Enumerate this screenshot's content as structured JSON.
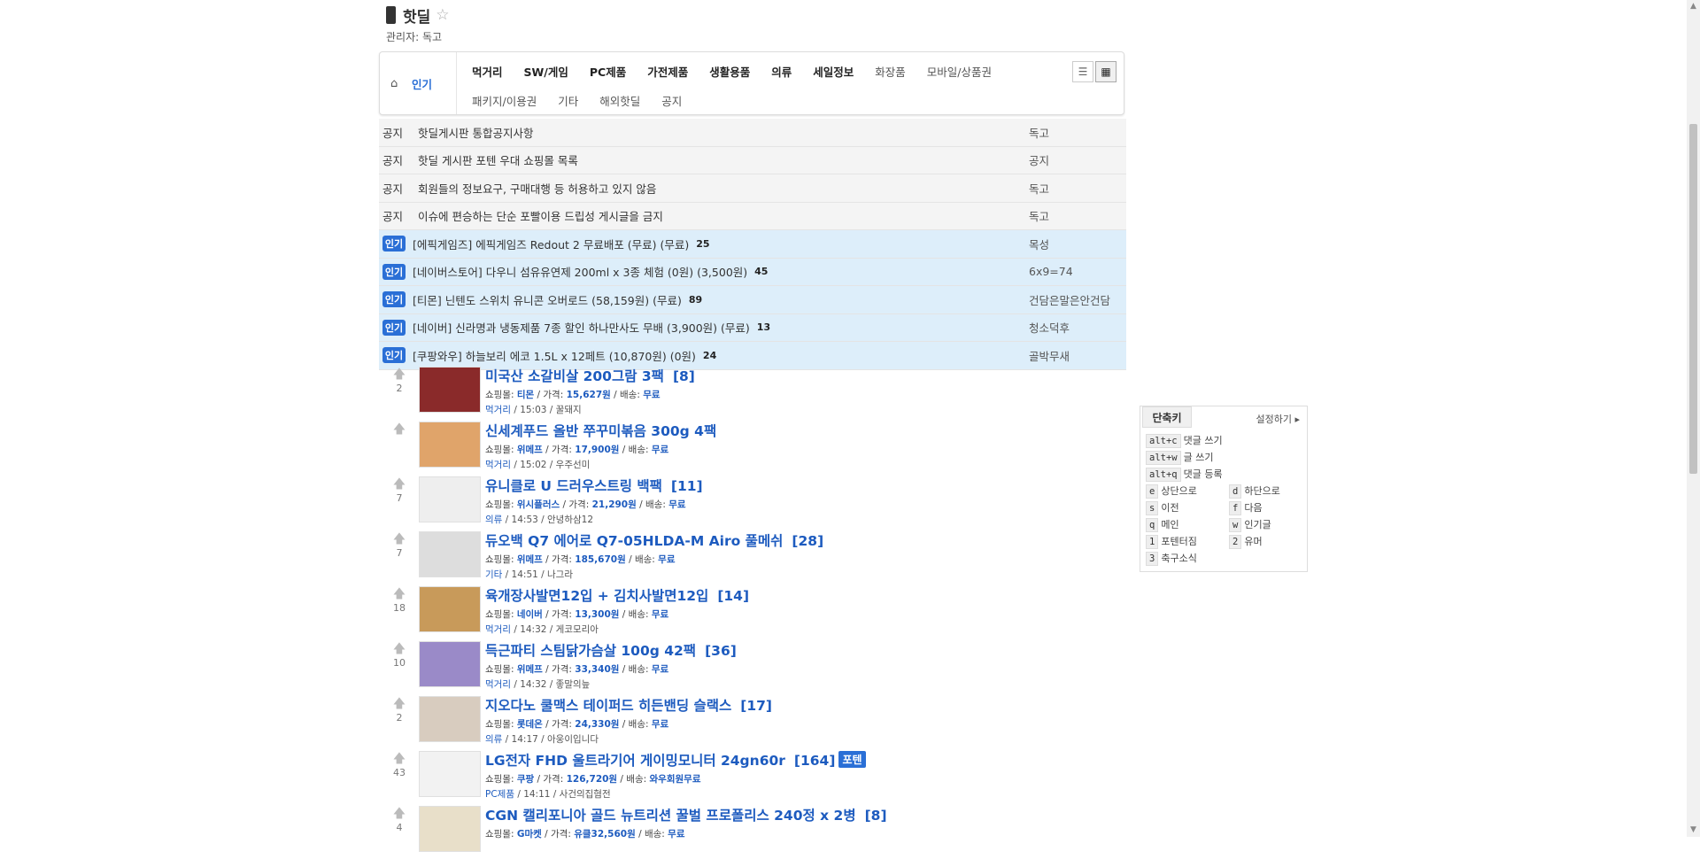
{
  "board": {
    "title": "핫딜",
    "admin": "관리자: 독고"
  },
  "nav": {
    "popular": "인기",
    "row1": [
      "먹거리",
      "SW/게임",
      "PC제품",
      "가전제품",
      "생활용품",
      "의류",
      "세일정보",
      "화장품",
      "모바일/상품권"
    ],
    "row2": [
      "패키지/이용권",
      "기타",
      "해외핫딜",
      "공지"
    ]
  },
  "notices": [
    {
      "tag": "공지",
      "subject": "핫딜게시판 통합공지사항",
      "author": "독고"
    },
    {
      "tag": "공지",
      "subject": "핫딜 게시판 포텐 우대 쇼핑몰 목록",
      "author": "공지"
    },
    {
      "tag": "공지",
      "subject": "회원들의 정보요구, 구매대행 등 허용하고 있지 않음",
      "author": "독고"
    },
    {
      "tag": "공지",
      "subject": "이슈에 편승하는 단순 포빨이용 드립성 게시글을 금지",
      "author": "독고"
    }
  ],
  "hot": [
    {
      "tag": "인기",
      "subject": "[에픽게임즈] 에픽게임즈 Redout 2 무료배포 (무료) (무료)",
      "comments": "25",
      "author": "목성"
    },
    {
      "tag": "인기",
      "subject": "[네이버스토어] 다우니 섬유유연제 200ml x 3종 체험 (0원) (3,500원)",
      "comments": "45",
      "author": "6x9=74"
    },
    {
      "tag": "인기",
      "subject": "[티몬] 닌텐도 스위치 유니콘 오버로드 (58,159원) (무료)",
      "comments": "89",
      "author": "건담은말은안건담"
    },
    {
      "tag": "인기",
      "subject": "[네이버] 신라명과 냉동제품 7종 할인 하나만사도 무배 (3,900원) (무료)",
      "comments": "13",
      "author": "청소덕후"
    },
    {
      "tag": "인기",
      "subject": "[쿠팡와우] 하늘보리 에코 1.5L x 12페트 (10,870원) (0원)",
      "comments": "24",
      "author": "골박무새"
    }
  ],
  "deal_labels": {
    "shop": "쇼핑몰: ",
    "price": " / 가격: ",
    "ship": " / 배송: "
  },
  "deals": [
    {
      "votes": "2",
      "title": "미국산 소갈비살 200그람 3팩",
      "count": "[8]",
      "shop": "티몬",
      "price": "15,627원",
      "ship": "무료",
      "cat": "먹거리",
      "time_user": " / 15:03 / 꿀돼지",
      "badge": ""
    },
    {
      "votes": "",
      "title": "신세계푸드 올반 쭈꾸미볶음 300g 4팩",
      "count": "",
      "shop": "위메프",
      "price": "17,900원",
      "ship": "무료",
      "cat": "먹거리",
      "time_user": " / 15:02 / 우주선미",
      "badge": ""
    },
    {
      "votes": "7",
      "title": "유니클로 U 드러우스트링 백팩",
      "count": "[11]",
      "shop": "위시플러스",
      "price": "21,290원",
      "ship": "무료",
      "cat": "의류",
      "time_user": " / 14:53 / 안녕하삼12",
      "badge": ""
    },
    {
      "votes": "7",
      "title": "듀오백 Q7 에어로 Q7-05HLDA-M Airo 풀메쉬",
      "count": "[28]",
      "shop": "위메프",
      "price": "185,670원",
      "ship": "무료",
      "cat": "기타",
      "time_user": " / 14:51 / 나그라",
      "badge": ""
    },
    {
      "votes": "18",
      "title": "육개장사발면12입 + 김치사발면12입",
      "count": "[14]",
      "shop": "네이버",
      "price": "13,300원",
      "ship": "무료",
      "cat": "먹거리",
      "time_user": " / 14:32 / 게코모리아",
      "badge": ""
    },
    {
      "votes": "10",
      "title": "득근파티 스팀닭가슴살 100g 42팩",
      "count": "[36]",
      "shop": "위메프",
      "price": "33,340원",
      "ship": "무료",
      "cat": "먹거리",
      "time_user": " / 14:32 / 좋말의늪",
      "badge": ""
    },
    {
      "votes": "2",
      "title": "지오다노 쿨맥스 테이퍼드 히든밴딩 슬랙스",
      "count": "[17]",
      "shop": "롯데온",
      "price": "24,330원",
      "ship": "무료",
      "cat": "의류",
      "time_user": " / 14:17 / 아웅이입니다",
      "badge": ""
    },
    {
      "votes": "43",
      "title": "LG전자 FHD 울트라기어 게이밍모니터 24gn60r",
      "count": "[164]",
      "shop": "쿠팡",
      "price": "126,720원",
      "ship": "와우회원무료",
      "cat": "PC제품",
      "time_user": " / 14:11 / 사건의집혐전",
      "badge": "포텐"
    },
    {
      "votes": "4",
      "title": "CGN 캘리포니아 골드 뉴트리션 꿀벌 프로폴리스 240정 x 2병",
      "count": "[8]",
      "shop": "G마켓",
      "price": "유클32,560원",
      "ship": "무료",
      "cat": "",
      "time_user": "",
      "badge": ""
    }
  ],
  "shortcut": {
    "tab": "단축키",
    "settings": "설정하기",
    "left": [
      {
        "key": "alt+c",
        "label": "댓글 쓰기"
      },
      {
        "key": "alt+w",
        "label": "글 쓰기"
      },
      {
        "key": "alt+q",
        "label": "댓글 등록"
      },
      {
        "key": "e",
        "label": "상단으로"
      },
      {
        "key": "s",
        "label": "이전"
      },
      {
        "key": "q",
        "label": "메인"
      },
      {
        "key": "1",
        "label": "포텐터짐"
      },
      {
        "key": "3",
        "label": "축구소식"
      }
    ],
    "right": [
      {
        "key": "d",
        "label": "하단으로"
      },
      {
        "key": "f",
        "label": "다음"
      },
      {
        "key": "w",
        "label": "인기글"
      },
      {
        "key": "2",
        "label": "유머"
      }
    ]
  },
  "colors": {
    "accent": "#2a6fd6",
    "link": "#1d5bbf",
    "hot_bg": "#ddeefa",
    "notice_bg": "#f4f4f4"
  }
}
